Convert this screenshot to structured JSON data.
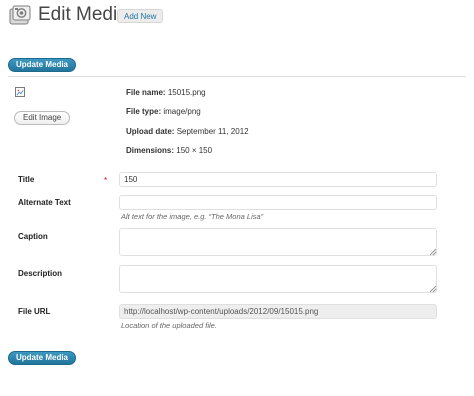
{
  "header": {
    "title": "Edit Media",
    "add_new_label": "Add New",
    "icon": "media-icon"
  },
  "actions": {
    "update_label": "Update Media",
    "edit_image_label": "Edit Image"
  },
  "meta": {
    "file_name_label": "File name:",
    "file_name": "15015.png",
    "file_type_label": "File type:",
    "file_type": "image/png",
    "upload_date_label": "Upload date:",
    "upload_date": "September 11, 2012",
    "dimensions_label": "Dimensions:",
    "dimensions": "150 × 150"
  },
  "form": {
    "title_label": "Title",
    "required_marker": "*",
    "title_value": "150",
    "alt_label": "Alternate Text",
    "alt_value": "",
    "alt_hint": "Alt text for the image, e.g. “The Mona Lisa”",
    "caption_label": "Caption",
    "caption_value": "",
    "description_label": "Description",
    "description_value": "",
    "file_url_label": "File URL",
    "file_url_value": "http://localhost/wp-content/uploads/2012/09/15015.png",
    "file_url_hint": "Location of the uploaded file."
  },
  "colors": {
    "primary_button": "#21759b",
    "link": "#21759b",
    "required": "#dd0000"
  }
}
